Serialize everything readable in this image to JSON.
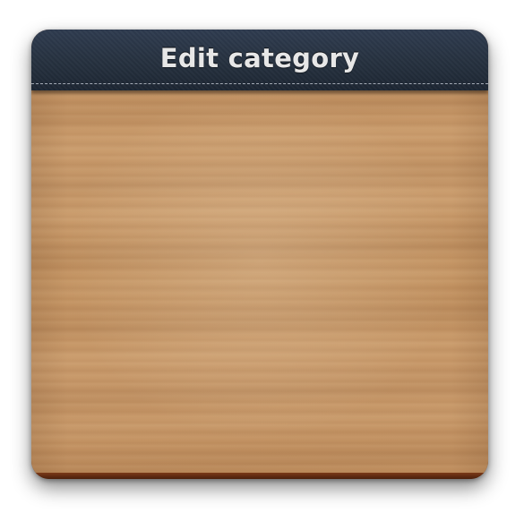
{
  "dialog": {
    "title": "Edit category"
  },
  "colors": {
    "header": "#26313f",
    "title_text": "#e7e7e7",
    "wood": "#c49464",
    "bottom_edge": "#5e2a12"
  }
}
